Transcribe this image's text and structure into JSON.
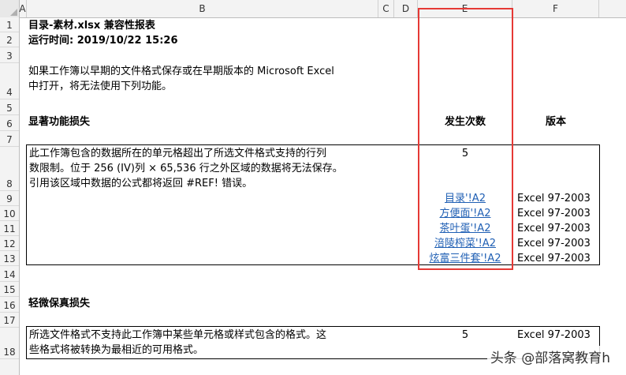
{
  "columns": [
    "A",
    "B",
    "C",
    "D",
    "E",
    "F"
  ],
  "rows": [
    "1",
    "2",
    "3",
    "4",
    "5",
    "6",
    "7",
    "8",
    "9",
    "10",
    "11",
    "12",
    "13",
    "14",
    "15",
    "16",
    "17",
    "18"
  ],
  "report": {
    "title": "目录-素材.xlsx 兼容性报表",
    "runtime": "运行时间: 2019/10/22 15:26",
    "intro_line1": "如果工作簿以早期的文件格式保存或在早期版本的 Microsoft Excel",
    "intro_line2": "中打开，将无法使用下列功能。",
    "section1": "显著功能损失",
    "count_header": "发生次数",
    "version_header": "版本",
    "issue1_line1": "此工作簿包含的数据所在的单元格超出了所选文件格式支持的行列",
    "issue1_line2": "数限制。位于 256 (IV)列 × 65,536 行之外区域的数据将无法保存。",
    "issue1_line3": "引用该区域中数据的公式都将返回 #REF! 错误。",
    "issue1_count": "5",
    "links": [
      {
        "label": "目录'!A2",
        "version": "Excel 97-2003"
      },
      {
        "label": "方便面'!A2",
        "version": "Excel 97-2003"
      },
      {
        "label": "茶叶蛋'!A2",
        "version": "Excel 97-2003"
      },
      {
        "label": "涪陵榨菜'!A2",
        "version": "Excel 97-2003"
      },
      {
        "label": "炫富三件套'!A2",
        "version": "Excel 97-2003"
      }
    ],
    "section2": "轻微保真损失",
    "issue2_line1": "所选文件格式不支持此工作簿中某些单元格或样式包含的格式。这",
    "issue2_line2": "些格式将被转换为最相近的可用格式。",
    "issue2_count": "5",
    "issue2_version": "Excel 97-2003"
  },
  "watermark": "头条 @部落窝教育h"
}
